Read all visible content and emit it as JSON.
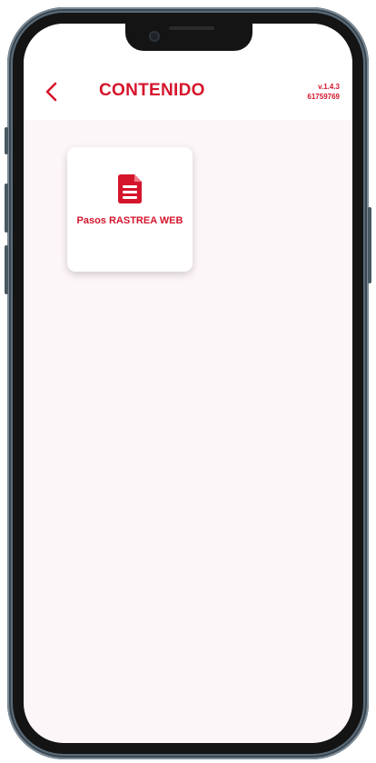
{
  "header": {
    "title": "CONTENIDO",
    "back_icon": "chevron-left-icon",
    "version": "v.1.4.3",
    "build": "61759769"
  },
  "content": {
    "cards": [
      {
        "icon": "document-icon",
        "label": "Pasos RASTREA WEB"
      }
    ]
  },
  "colors": {
    "accent": "#d5152c",
    "background": "#fdf6f8",
    "header_background": "#ffffff"
  }
}
